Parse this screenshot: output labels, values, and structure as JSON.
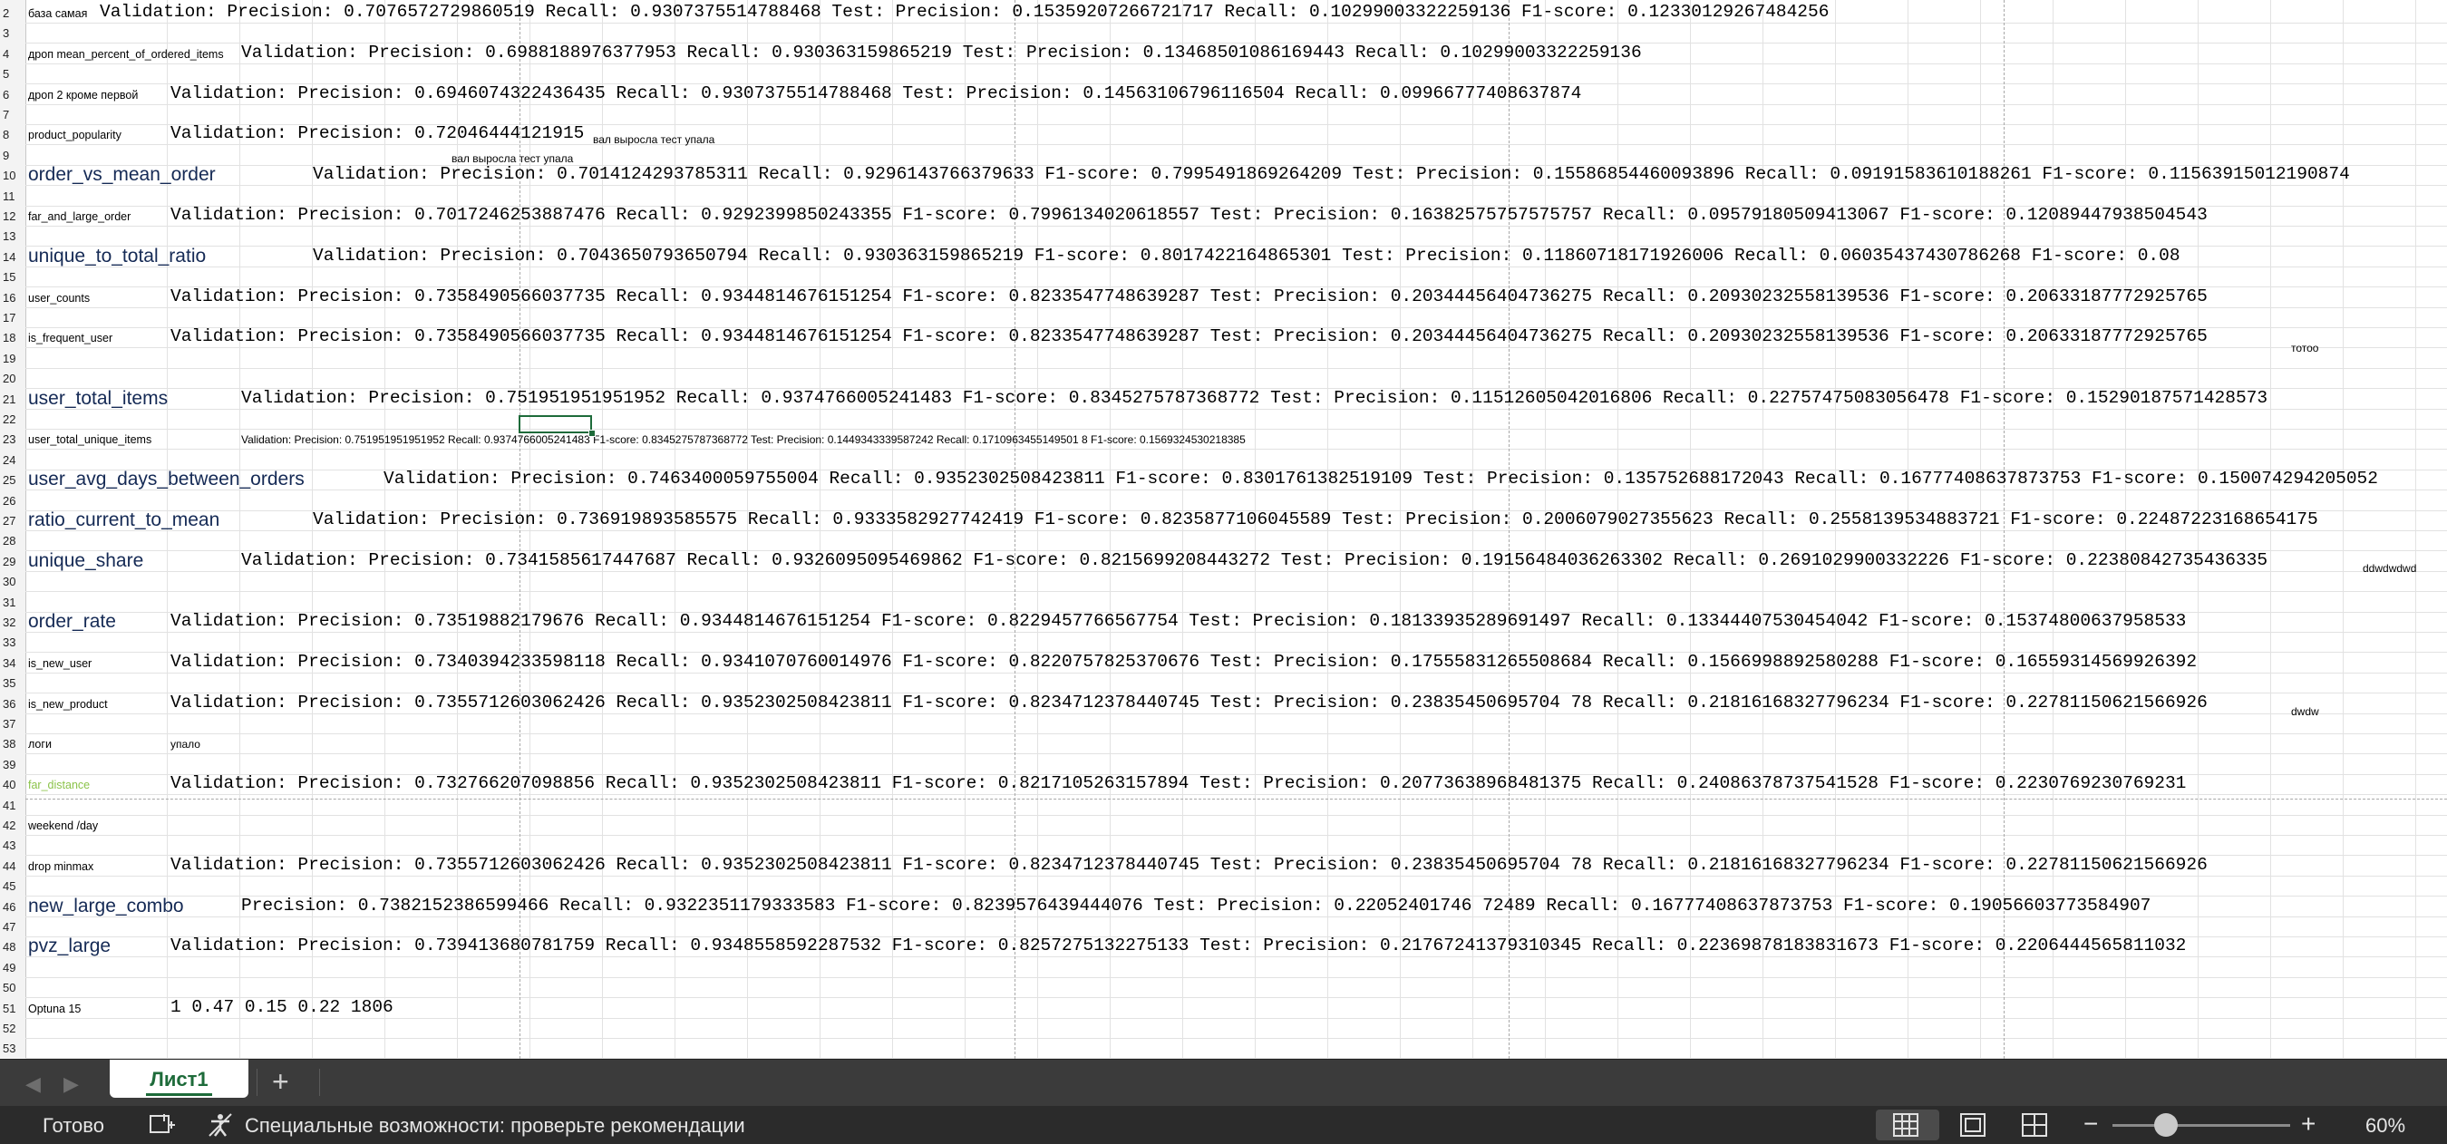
{
  "sheet": {
    "row_numbers": [
      "2",
      "3",
      "4",
      "5",
      "6",
      "7",
      "8",
      "9",
      "10",
      "11",
      "12",
      "13",
      "14",
      "15",
      "16",
      "17",
      "18",
      "19",
      "20",
      "21",
      "22",
      "23",
      "24",
      "25",
      "26",
      "27",
      "28",
      "29",
      "30",
      "31",
      "32",
      "33",
      "34",
      "35",
      "36",
      "37",
      "38",
      "39",
      "40",
      "41",
      "42",
      "43",
      "44",
      "45",
      "46",
      "47",
      "48",
      "49",
      "50",
      "51",
      "52",
      "53"
    ],
    "rows": [
      {
        "label": "база самая",
        "label_style": "small",
        "text": "Validation: Precision: 0.7076572729860519 Recall: 0.9307375514788468 Test: Precision: 0.15359207266721717 Recall: 0.10299003322259136    F1-score: 0.12330129267484256"
      },
      {
        "label": "дроп mean_percent_of_ordered_items",
        "label_style": "small",
        "text": "Validation: Precision: 0.6988188976377953 Recall: 0.930363159865219 Test: Precision: 0.13468501086169443 Recall: 0.10299003322259136"
      },
      {
        "label": "дроп 2 кроме первой",
        "label_style": "small",
        "text": "Validation: Precision: 0.6946074322436435 Recall: 0.9307375514788468 Test: Precision: 0.14563106796116504 Recall: 0.09966777408637874"
      },
      {
        "label": "product_popularity",
        "label_style": "small",
        "text": "Validation: Precision: 0.72046444121915"
      },
      {
        "label": "order_vs_mean_order",
        "label_style": "big",
        "text": "Validation: Precision: 0.7014124293785311 Recall: 0.9296143766379633 F1-score: 0.7995491869264209 Test: Precision: 0.15586854460093896 Recall: 0.09191583610188261 F1-score: 0.11563915012190874"
      },
      {
        "label": "far_and_large_order",
        "label_style": "small",
        "text": "Validation: Precision: 0.7017246253887476 Recall: 0.9292399850243355 F1-score: 0.7996134020618557 Test: Precision: 0.16382575757575757 Recall: 0.09579180509413067 F1-score: 0.12089447938504543"
      },
      {
        "label": "unique_to_total_ratio",
        "label_style": "big",
        "text": "Validation: Precision: 0.7043650793650794 Recall: 0.930363159865219 F1-score: 0.8017422164865301 Test: Precision: 0.11860718171926006 Recall: 0.06035437430786268 F1-score: 0.08"
      },
      {
        "label": "user_counts",
        "label_style": "small",
        "text": "Validation: Precision: 0.7358490566037735 Recall: 0.9344814676151254 F1-score: 0.8233547748639287 Test: Precision: 0.20344456404736275 Recall: 0.20930232558139536 F1-score: 0.20633187772925765"
      },
      {
        "label": "is_frequent_user",
        "label_style": "small",
        "text": "Validation: Precision: 0.7358490566037735 Recall: 0.9344814676151254 F1-score: 0.8233547748639287 Test: Precision: 0.20344456404736275 Recall: 0.20930232558139536 F1-score: 0.20633187772925765"
      },
      {
        "label": "user_total_items",
        "label_style": "big",
        "text": "Validation: Precision: 0.751951951951952 Recall: 0.9374766005241483 F1-score: 0.8345275787368772 Test: Precision: 0.11512605042016806 Recall: 0.22757475083056478 F1-score: 0.15290187571428573"
      },
      {
        "label": "user_total_unique_items",
        "label_style": "small",
        "text": "Validation: Precision: 0.751951951951952 Recall: 0.9374766005241483 F1-score: 0.8345275787368772 Test: Precision: 0.1449343339587242 Recall: 0.1710963455149501 8 F1-score: 0.1569324530218385"
      },
      {
        "label": "user_avg_days_between_orders",
        "label_style": "big",
        "text": "Validation: Precision: 0.7463400059755004 Recall: 0.9352302508423811 F1-score: 0.8301761382519109 Test: Precision: 0.135752688172043 Recall: 0.16777408637873753 F1-score: 0.150074294205052"
      },
      {
        "label": "ratio_current_to_mean",
        "label_style": "big",
        "text": "Validation: Precision: 0.736919893585575 Recall: 0.9333582927742419 F1-score: 0.8235877106045589 Test: Precision: 0.2006079027355623 Recall: 0.2558139534883721 F1-score: 0.22487223168654175"
      },
      {
        "label": "unique_share",
        "label_style": "big",
        "text": "Validation: Precision: 0.7341585617447687 Recall: 0.9326095095469862 F1-score: 0.8215699208443272 Test: Precision: 0.19156484036263302 Recall: 0.2691029900332226 F1-score: 0.22380842735436335"
      },
      {
        "label": "order_rate",
        "label_style": "big",
        "text": "Validation: Precision: 0.73519882179676 Recall: 0.9344814676151254 F1-score: 0.8229457766567754 Test: Precision: 0.18133935289691497 Recall: 0.13344407530454042 F1-score: 0.15374800637958533"
      },
      {
        "label": "is_new_user",
        "label_style": "small",
        "text": "Validation: Precision: 0.7340394233598118 Recall: 0.9341070760014976 F1-score: 0.8220757825370676 Test: Precision: 0.17555831265508684 Recall: 0.1566998892580288 F1-score: 0.16559314569926392"
      },
      {
        "label": "is_new_product",
        "label_style": "small",
        "text": "Validation: Precision: 0.7355712603062426 Recall: 0.9352302508423811 F1-score: 0.8234712378440745 Test: Precision: 0.23835450695704 78 Recall: 0.21816168327796234 F1-score: 0.22781150621566926"
      },
      {
        "label": "логи",
        "label_style": "small",
        "text": "упало"
      },
      {
        "label": "far_distance",
        "label_style": "green",
        "text": "Validation: Precision: 0.732766207098856 Recall: 0.9352302508423811 F1-score: 0.8217105263157894 Test: Precision: 0.20773638968481375 Recall: 0.24086378737541528 F1-score: 0.2230769230769231"
      },
      {
        "label": "weekend /day",
        "label_style": "small",
        "text": ""
      },
      {
        "label": "drop minmax",
        "label_style": "small",
        "text": "Validation: Precision: 0.7355712603062426 Recall: 0.9352302508423811 F1-score: 0.8234712378440745 Test: Precision: 0.23835450695704 78 Recall: 0.21816168327796234 F1-score: 0.22781150621566926"
      },
      {
        "label": "new_large_combo",
        "label_style": "big",
        "text": "Precision: 0.7382152386599466 Recall: 0.9322351179333583 F1-score: 0.8239576439444076 Test: Precision: 0.22052401746 72489 Recall: 0.16777408637873753 F1-score: 0.19056603773584907"
      },
      {
        "label": "pvz_large",
        "label_style": "big",
        "text": "Validation: Precision: 0.739413680781759 Recall: 0.9348558592287532 F1-score: 0.8257275132275133 Test: Precision: 0.21767241379310345 Recall: 0.22369878183831673 F1-score: 0.2206444565811032"
      },
      {
        "label": "Optuna 15",
        "label_style": "small",
        "text": "1 0.47 0.15 0.22 1806"
      }
    ],
    "notes": {
      "row8_note": "вал выросла тест упала",
      "row9_note": "вал выросла тест упала",
      "row18_note": "тотоо",
      "row29_note": "ddwdwdwd",
      "row36_note": "dwdw"
    }
  },
  "tabs": {
    "sheet_name": "Лист1",
    "prev_icon": "chevron-left-icon",
    "next_icon": "chevron-right-icon",
    "add_icon": "plus-icon"
  },
  "status": {
    "ready": "Готово",
    "accessibility": "Специальные возможности: проверьте рекомендации",
    "zoom": "60%",
    "zoom_level_percent": 60
  }
}
